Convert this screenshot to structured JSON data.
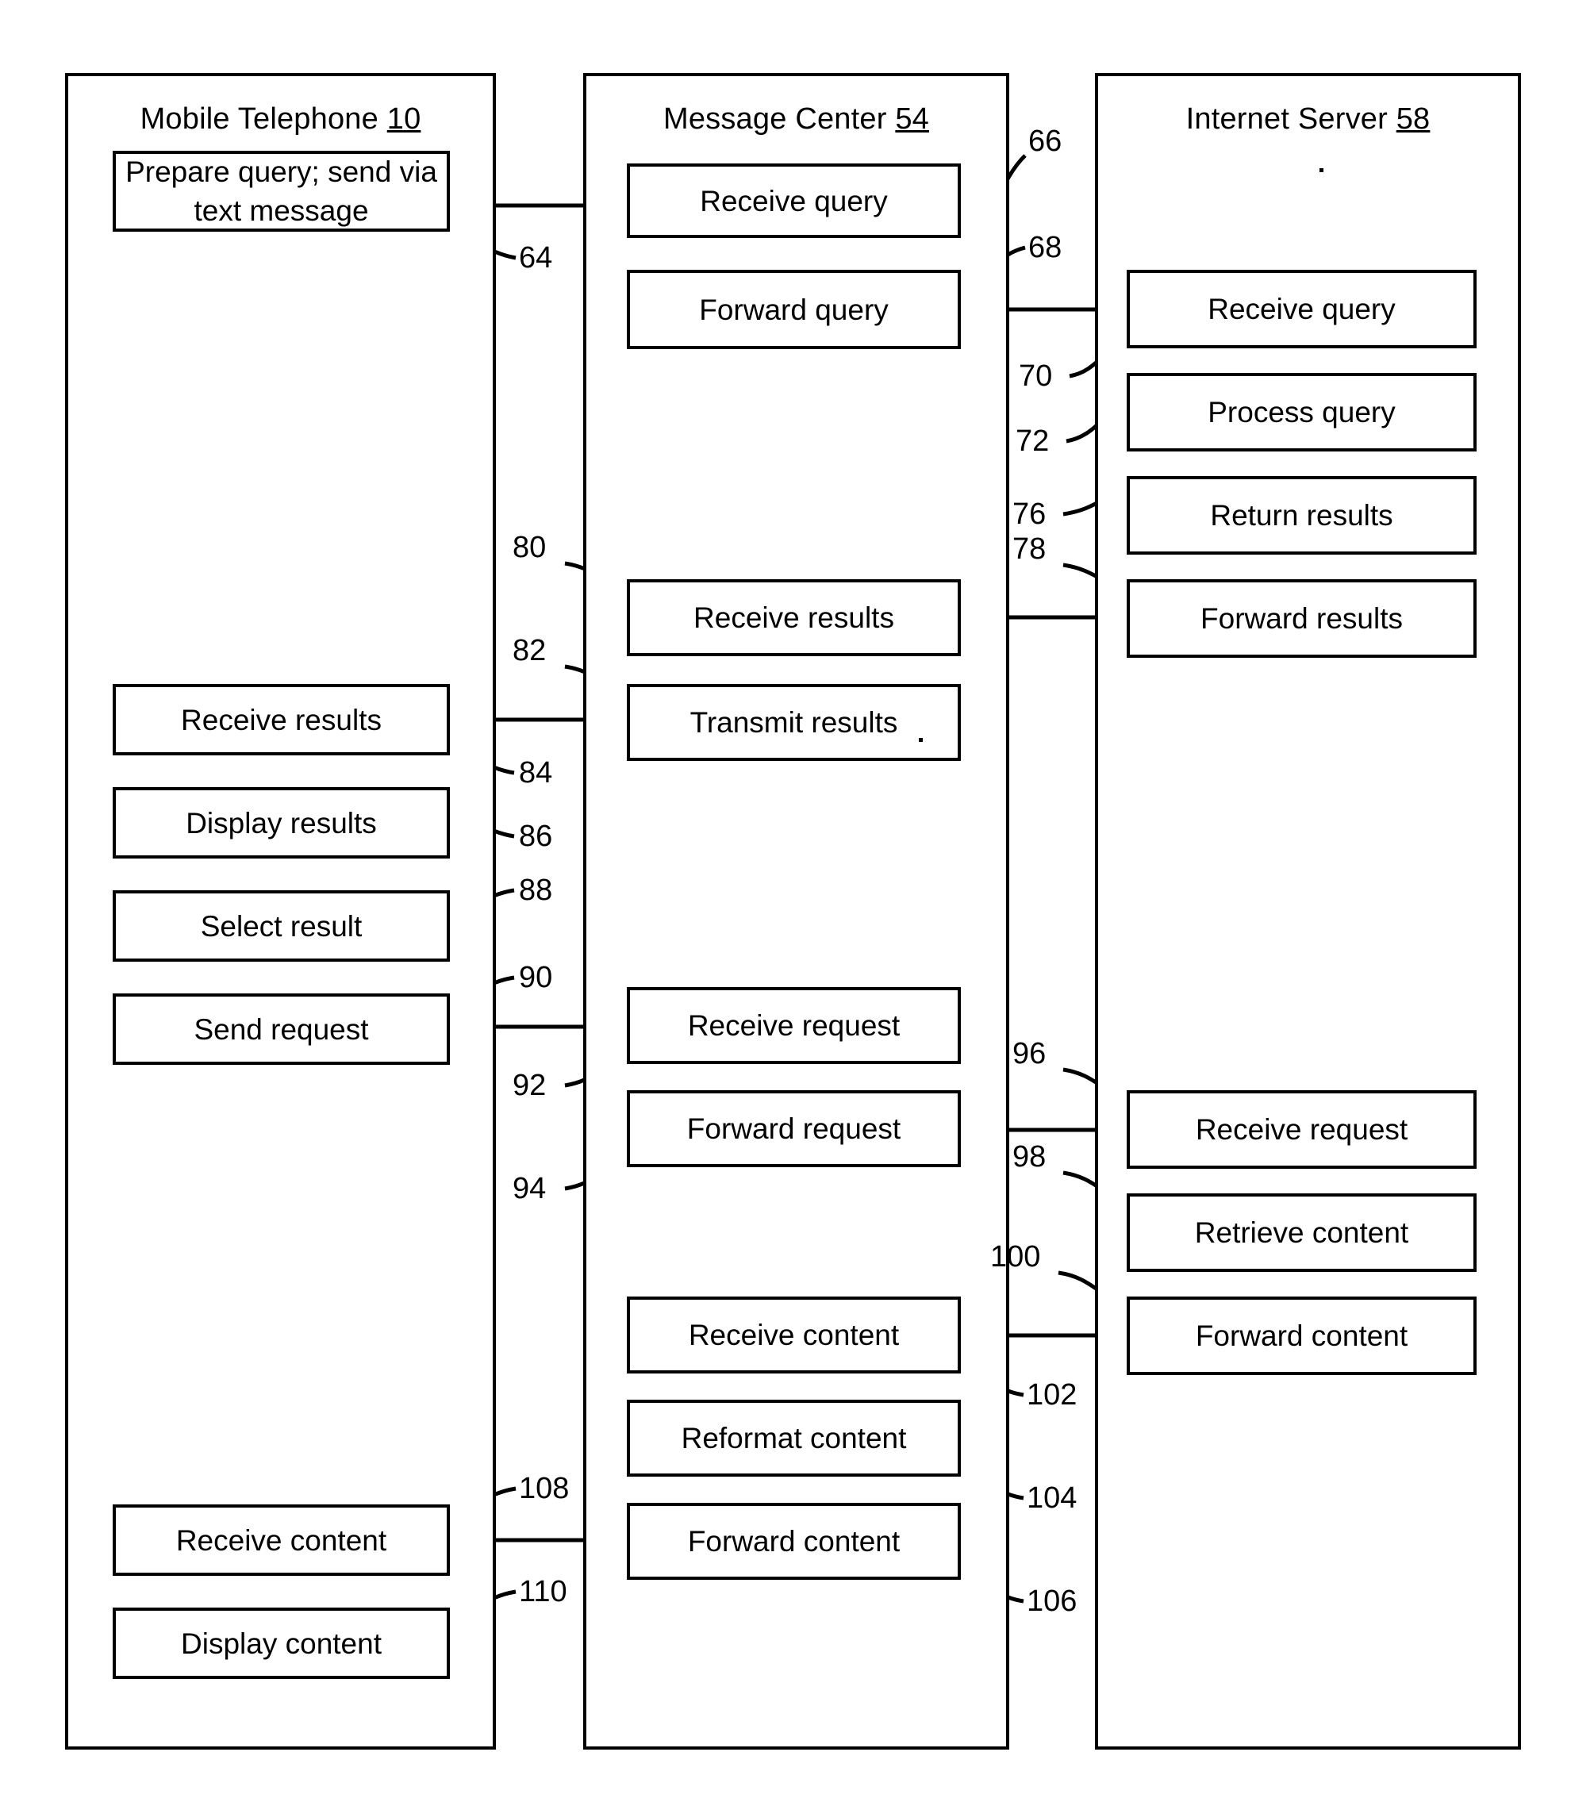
{
  "figure": {
    "title": "Message-center mediated mobile query and content retrieval flowchart",
    "line_color": "#000000",
    "background_color": "#ffffff"
  },
  "lanes": [
    {
      "id": "mobile",
      "title": "Mobile Telephone",
      "ref": "10",
      "steps": [
        {
          "ref": "64",
          "label": "Prepare query; send via text message"
        },
        {
          "ref": "84",
          "label": "Receive results"
        },
        {
          "ref": "86",
          "label": "Display results"
        },
        {
          "ref": "88",
          "label": "Select result"
        },
        {
          "ref": "90",
          "label": "Send request"
        },
        {
          "ref": "108",
          "label": "Receive content"
        },
        {
          "ref": "110",
          "label": "Display content"
        }
      ]
    },
    {
      "id": "message_center",
      "title": "Message Center",
      "ref": "54",
      "steps": [
        {
          "ref": "66",
          "label": "Receive query"
        },
        {
          "ref": "68",
          "label": "Forward query"
        },
        {
          "ref": "80",
          "label": "Receive results"
        },
        {
          "ref": "82",
          "label": "Transmit results"
        },
        {
          "ref": "92",
          "label": "Receive request"
        },
        {
          "ref": "94",
          "label": "Forward request"
        },
        {
          "ref": "102",
          "label": "Receive content"
        },
        {
          "ref": "104",
          "label": "Reformat content"
        },
        {
          "ref": "106",
          "label": "Forward content"
        }
      ]
    },
    {
      "id": "internet_server",
      "title": "Internet Server",
      "ref": "58",
      "steps": [
        {
          "ref": "70",
          "label": "Receive query"
        },
        {
          "ref": "72",
          "label": "Process query"
        },
        {
          "ref": "76",
          "label": "Return results"
        },
        {
          "ref": "78",
          "label": "Forward results"
        },
        {
          "ref": "96",
          "label": "Receive request"
        },
        {
          "ref": "98",
          "label": "Retrieve content"
        },
        {
          "ref": "100",
          "label": "Forward content"
        }
      ]
    }
  ],
  "flows": [
    {
      "from": "64",
      "to": "66",
      "direction": "right"
    },
    {
      "from": "68",
      "to": "70",
      "direction": "right"
    },
    {
      "from": "78",
      "to": "80",
      "direction": "left"
    },
    {
      "from": "82",
      "to": "84",
      "direction": "left"
    },
    {
      "from": "90",
      "to": "92",
      "direction": "right"
    },
    {
      "from": "94",
      "to": "96",
      "direction": "right"
    },
    {
      "from": "100",
      "to": "102",
      "direction": "left"
    },
    {
      "from": "106",
      "to": "108",
      "direction": "left"
    }
  ]
}
